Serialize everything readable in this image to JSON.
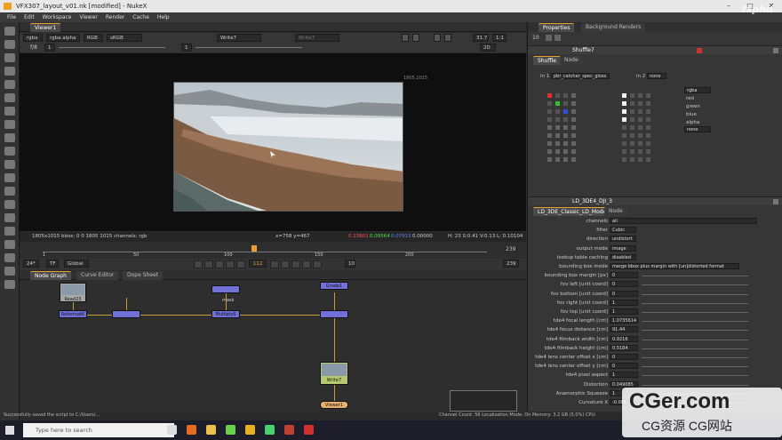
{
  "window": {
    "title": "VFX307_layout_v01.nk [modified] - NukeX",
    "controls": [
      "–",
      "□",
      "✕"
    ]
  },
  "menubar": [
    "File",
    "Edit",
    "Workspace",
    "Viewer",
    "Render",
    "Cache",
    "Help"
  ],
  "viewer": {
    "tab": "Viewer1",
    "channels": "rgba",
    "layer": "rgba.alpha",
    "colorspace": "RGB",
    "lut": "sRGB",
    "input_a": "Write7",
    "input_b": "Write7",
    "zoom": "31.7",
    "ratio": "1:1",
    "fstop": "f/8",
    "frame_field": "1",
    "gamma": "1",
    "mode": "2D",
    "resolution_label": "1805,1015",
    "info_left": "1805x1015   bbox: 0 0 1805 1015 channels: rgb",
    "info_coord": "x=758 y=467",
    "info_r": "0.13801",
    "info_g": "0.09564",
    "info_b": "0.07915",
    "info_a": "0.00000",
    "info_hsv": "H: 23 S:0.41 V:0.13  L: 0.10104"
  },
  "timeline": {
    "ticks": [
      "1",
      "50",
      "100",
      "150",
      "200",
      "239"
    ],
    "current": "112",
    "end": "239",
    "fps": "24*",
    "format": "TF",
    "scope": "Global",
    "step": "10",
    "playhead_fraction": 0.47
  },
  "nodegraph": {
    "tabs": [
      "Node Graph",
      "Curve Editor",
      "Dope Sheet"
    ],
    "nodes": {
      "read": "Read23",
      "reformat": "Reformat6",
      "mask": "mask",
      "multiply": "Multiply6",
      "grade": "Grade1",
      "write": "Write7",
      "viewer": "Viewer1"
    }
  },
  "statusbar": {
    "left": "Successfully saved the script to C:/Users/...",
    "right": "Channel Count: 56  Localization Mode: On  Memory: 3.2 GB (5.0%)  CPU:"
  },
  "properties": {
    "tabs": [
      "Properties",
      "Background Renders"
    ],
    "count": "10",
    "shuffle": {
      "name": "Shuffle7",
      "subtabs": [
        "Shuffle",
        "Node"
      ],
      "in1_label": "in 1",
      "in1_value": "pbr_catcher_spec_gloss",
      "in2_label": "in 2",
      "in2_value": "none",
      "out_value": "rgba",
      "out_none": "none",
      "channels": [
        "red",
        "green",
        "blue",
        "alpha"
      ]
    },
    "lens": {
      "name": "LD_3DE4_DJI_3",
      "subtabs": [
        "LD_3DE_Classic_LD_Model",
        "Node"
      ],
      "rows": [
        {
          "label": "channels",
          "value": "all"
        },
        {
          "label": "filter",
          "value": "Cubic"
        },
        {
          "label": "direction",
          "value": "undistort"
        },
        {
          "label": "output mode",
          "value": "image"
        },
        {
          "label": "lookup table caching",
          "value": "disabled"
        },
        {
          "label": "bounding box mode",
          "value": "merge bbox plus margin with [un]distorted format"
        },
        {
          "label": "bounding box margin [px]",
          "value": "0"
        },
        {
          "label": "fov left [unit coord]",
          "value": "0"
        },
        {
          "label": "fov bottom [unit coord]",
          "value": "0"
        },
        {
          "label": "fov right [unit coord]",
          "value": "1"
        },
        {
          "label": "fov top [unit coord]",
          "value": "1"
        },
        {
          "label": "tde4 focal length [cm]",
          "value": "1.0735614"
        },
        {
          "label": "tde4 focus distance [cm]",
          "value": "91.44"
        },
        {
          "label": "tde4 filmback width [cm]",
          "value": "0.9216"
        },
        {
          "label": "tde4 filmback height [cm]",
          "value": "0.5184"
        },
        {
          "label": "tde4 lens center offset x [cm]",
          "value": "0"
        },
        {
          "label": "tde4 lens center offset y [cm]",
          "value": "0"
        },
        {
          "label": "tde4 pixel aspect",
          "value": "1"
        },
        {
          "label": "Distortion",
          "value": "0.049085"
        },
        {
          "label": "Anamorphic Squeeze",
          "value": "1"
        },
        {
          "label": "Curvature X",
          "value": "-0.001"
        }
      ]
    }
  },
  "taskbar": {
    "search_placeholder": "Type here to search"
  },
  "overlays": {
    "fxphd": "fxphd",
    "watermark_big": "CGer.com",
    "watermark_small": "CG资源 CG网站"
  },
  "colors": {
    "accent": "#e8a030",
    "node_read": "#a8a8a8",
    "node_merge": "#7070d8",
    "node_write": "#b8c870",
    "node_viewer": "#e8b070",
    "channel_red": "#e03030",
    "channel_green": "#30c030",
    "channel_blue": "#3050e0"
  }
}
